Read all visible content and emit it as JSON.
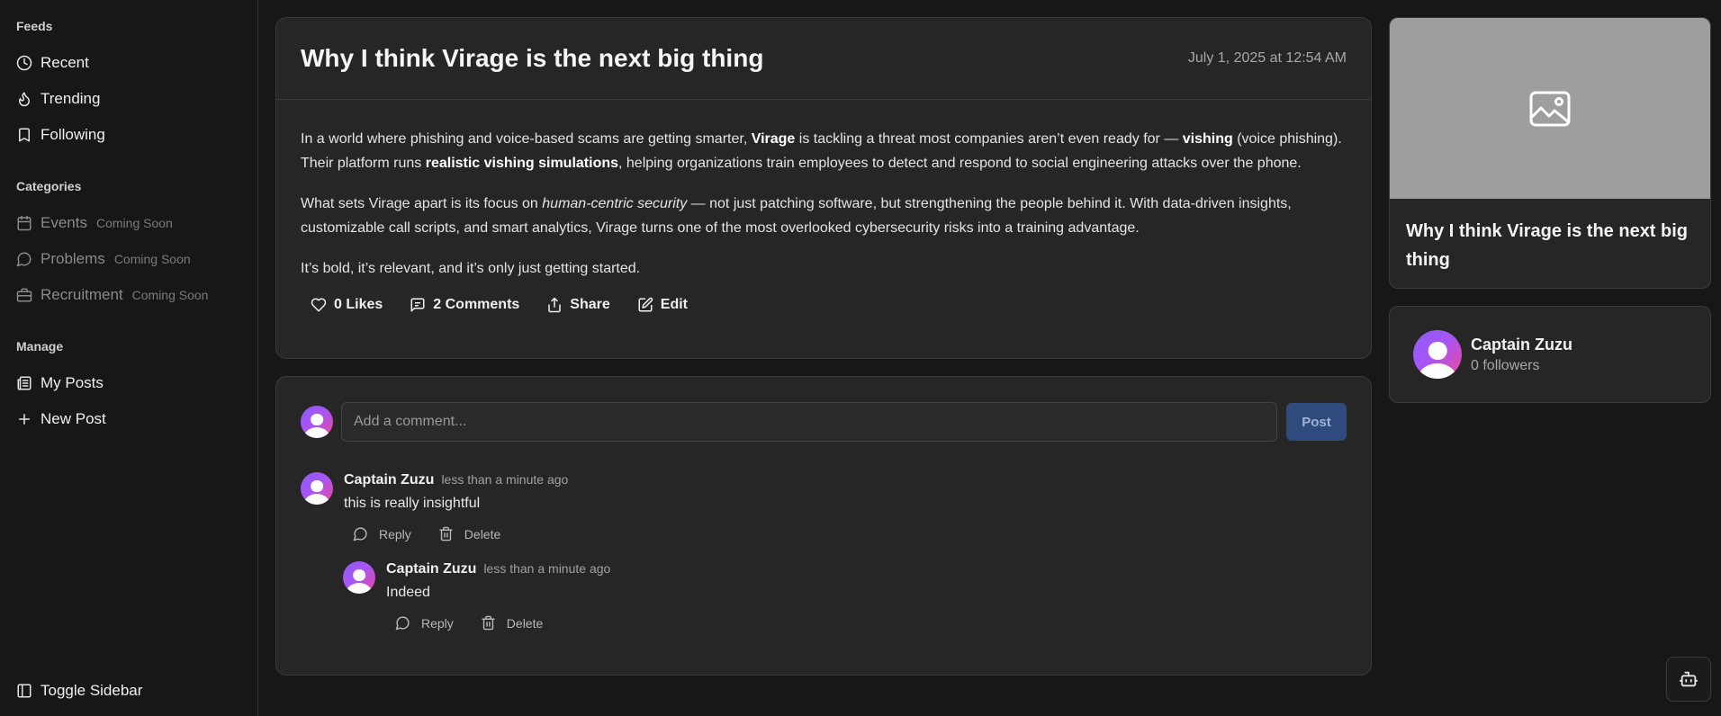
{
  "sidebar": {
    "feeds_heading": "Feeds",
    "feeds": [
      {
        "label": "Recent",
        "icon": "clock-icon"
      },
      {
        "label": "Trending",
        "icon": "flame-icon"
      },
      {
        "label": "Following",
        "icon": "bookmark-icon"
      }
    ],
    "categories_heading": "Categories",
    "categories": [
      {
        "label": "Events",
        "badge": "Coming Soon",
        "icon": "calendar-icon"
      },
      {
        "label": "Problems",
        "badge": "Coming Soon",
        "icon": "message-circle-icon"
      },
      {
        "label": "Recruitment",
        "badge": "Coming Soon",
        "icon": "briefcase-icon"
      }
    ],
    "manage_heading": "Manage",
    "manage": [
      {
        "label": "My Posts",
        "icon": "newspaper-icon"
      },
      {
        "label": "New Post",
        "icon": "plus-icon"
      }
    ],
    "toggle_label": "Toggle Sidebar"
  },
  "post": {
    "title": "Why I think Virage is the next big thing",
    "date": "July 1, 2025 at 12:54 AM",
    "p1": {
      "a": "In a world where phishing and voice-based scams are getting smarter, ",
      "b1": "Virage",
      "c": " is tackling a threat most companies aren’t even ready for — ",
      "b2": "vishing",
      "d": " (voice phishing). Their platform runs ",
      "b3": "realistic vishing simulations",
      "e": ", helping organizations train employees to detect and respond to social engineering attacks over the phone."
    },
    "p2": {
      "a": "What sets Virage apart is its focus on ",
      "i1": "human-centric security",
      "b": " — not just patching software, but strengthening the people behind it. With data-driven insights, customizable call scripts, and smart analytics, Virage turns one of the most overlooked cybersecurity risks into a training advantage."
    },
    "p3": "It’s bold, it’s relevant, and it’s only just getting started.",
    "actions": {
      "likes": "0 Likes",
      "comments": "2 Comments",
      "share": "Share",
      "edit": "Edit"
    }
  },
  "comments": {
    "placeholder": "Add a comment...",
    "post_button": "Post",
    "items": [
      {
        "author": "Captain Zuzu",
        "time": "less than a minute ago",
        "text": "this is really insightful",
        "reply": "Reply",
        "delete": "Delete"
      },
      {
        "author": "Captain Zuzu",
        "time": "less than a minute ago",
        "text": "Indeed",
        "reply": "Reply",
        "delete": "Delete"
      }
    ]
  },
  "preview": {
    "title": "Why I think Virage is the next big thing"
  },
  "author": {
    "name": "Captain Zuzu",
    "followers": "0 followers"
  },
  "colors": {
    "background": "#171717",
    "card": "#262626",
    "post_button": "#2f4a7d"
  }
}
